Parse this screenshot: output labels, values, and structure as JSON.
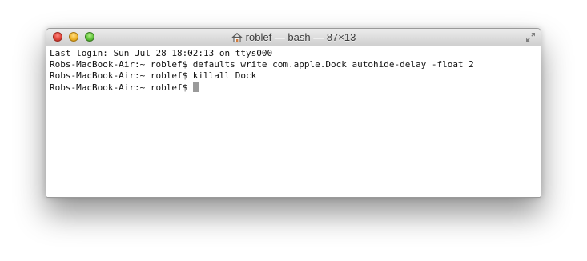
{
  "window": {
    "title": "roblef — bash — 87×13",
    "title_icon": "home-icon",
    "buttons": [
      "close",
      "minimize",
      "zoom"
    ]
  },
  "terminal": {
    "lines": [
      "Last login: Sun Jul 28 18:02:13 on ttys000",
      "Robs-MacBook-Air:~ roblef$ defaults write com.apple.Dock autohide-delay -float 2",
      "Robs-MacBook-Air:~ roblef$ killall Dock",
      "Robs-MacBook-Air:~ roblef$ "
    ],
    "cursor_color": "#9a9a9a",
    "text_color": "#111111",
    "background": "#ffffff"
  }
}
